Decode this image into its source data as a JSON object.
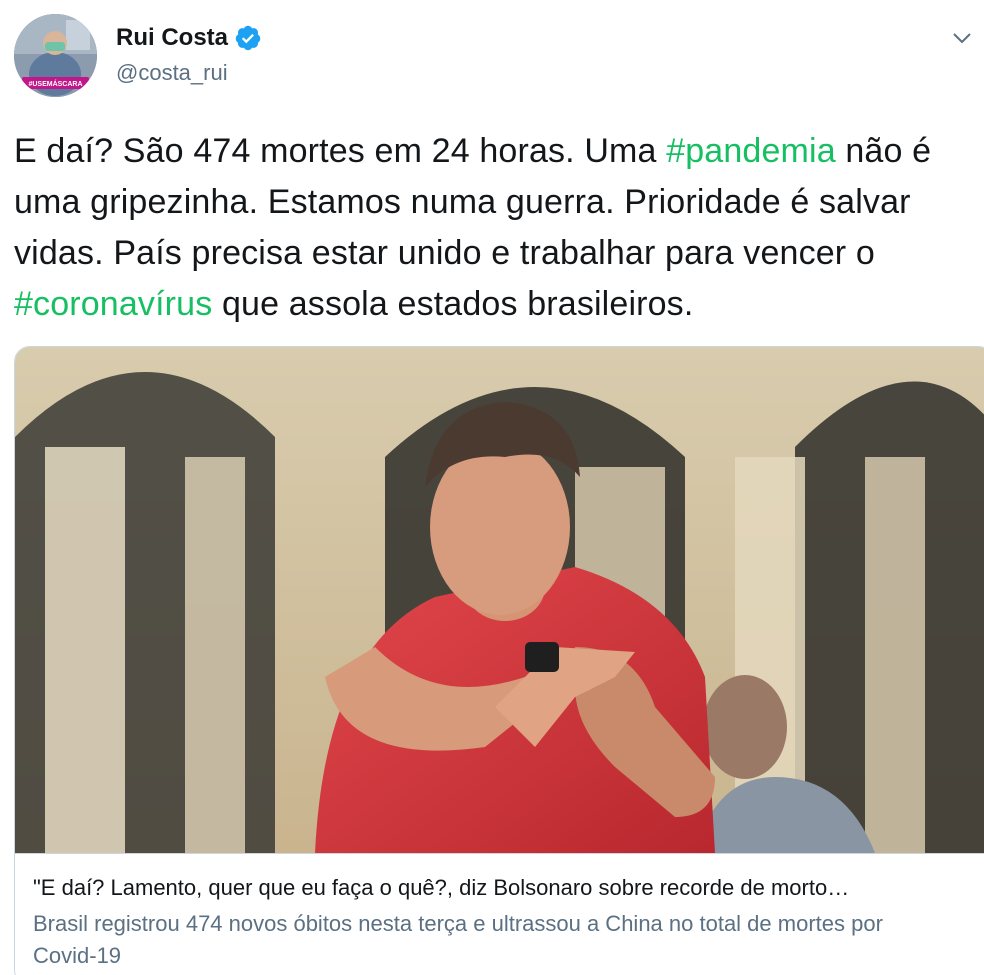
{
  "author": {
    "name": "Rui Costa",
    "handle": "@costa_rui",
    "avatar_badge": "#USEMÁSCARA",
    "verified_icon": "verified-badge-icon"
  },
  "menu_icon": "chevron-down-icon",
  "tweet": {
    "segments": [
      {
        "text": "E daí? São 474 mortes em 24 horas. Uma ",
        "type": "text"
      },
      {
        "text": "#pandemia",
        "type": "hashtag"
      },
      {
        "text": " não é uma gripezinha. Estamos numa guerra. Prioridade é salvar vidas. País precisa estar unido e trabalhar para vencer o ",
        "type": "text"
      },
      {
        "text": "#coronavírus",
        "type": "hashtag"
      },
      {
        "text": " que assola estados brasileiros.",
        "type": "text"
      }
    ]
  },
  "card": {
    "title": "\"E daí? Lamento, quer que eu faça o quê?, diz Bolsonaro sobre recorde de morto…",
    "description": "Brasil registrou 474 novos óbitos nesta terça e ultrassou a China no total de mortes por Covid-19"
  },
  "colors": {
    "hashtag": "#17bf63",
    "verified": "#1da1f2",
    "secondary_text": "#5b7083",
    "card_border": "#ccd6dd"
  }
}
